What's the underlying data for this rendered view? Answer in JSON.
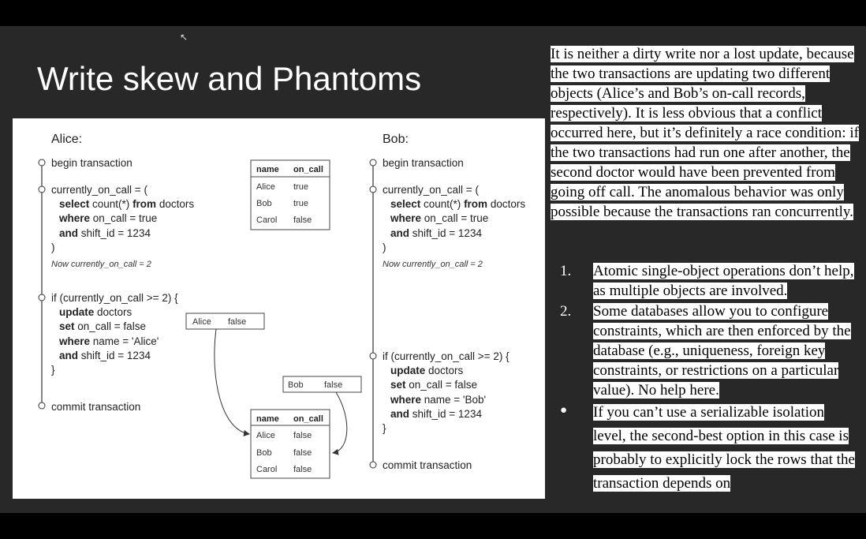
{
  "slide": {
    "title": "Write skew and Phantoms"
  },
  "diagram": {
    "alice": {
      "name": "Alice:",
      "begin": "begin transaction",
      "q_open": "currently_on_call = (",
      "q_select_kw": "select",
      "q_select_rest": " count(*) ",
      "q_from_kw": "from",
      "q_from_rest": " doctors",
      "q_where_kw": "where",
      "q_where_rest": " on_call = true",
      "q_and_kw": "and",
      "q_and_rest": " shift_id = 1234",
      "q_close": ")",
      "note": "Now currently_on_call = 2",
      "if_line": "if (currently_on_call >= 2) {",
      "u_update_kw": "update",
      "u_update_rest": " doctors",
      "u_set_kw": "set",
      "u_set_rest": " on_call = false",
      "u_where_kw": "where",
      "u_where_rest": " name = 'Alice'",
      "u_and_kw": "and",
      "u_and_rest": " shift_id = 1234",
      "if_close": "}",
      "commit": "commit transaction"
    },
    "bob": {
      "name": "Bob:",
      "begin": "begin transaction",
      "q_open": "currently_on_call = (",
      "q_select_kw": "select",
      "q_select_rest": " count(*) ",
      "q_from_kw": "from",
      "q_from_rest": " doctors",
      "q_where_kw": "where",
      "q_where_rest": " on_call = true",
      "q_and_kw": "and",
      "q_and_rest": " shift_id = 1234",
      "q_close": ")",
      "note": "Now currently_on_call = 2",
      "if_line": "if (currently_on_call >= 2) {",
      "u_update_kw": "update",
      "u_update_rest": " doctors",
      "u_set_kw": "set",
      "u_set_rest": " on_call = false",
      "u_where_kw": "where",
      "u_where_rest": " name = 'Bob'",
      "u_and_kw": "and",
      "u_and_rest": " shift_id = 1234",
      "if_close": "}",
      "commit": "commit transaction"
    },
    "table_before": {
      "headers": [
        "name",
        "on_call"
      ],
      "rows": [
        [
          "Alice",
          "true"
        ],
        [
          "Bob",
          "true"
        ],
        [
          "Carol",
          "false"
        ]
      ]
    },
    "table_after": {
      "headers": [
        "name",
        "on_call"
      ],
      "rows": [
        [
          "Alice",
          "false"
        ],
        [
          "Bob",
          "false"
        ],
        [
          "Carol",
          "false"
        ]
      ]
    },
    "alice_write": {
      "name": "Alice",
      "value": "false"
    },
    "bob_write": {
      "name": "Bob",
      "value": "false"
    }
  },
  "notes": {
    "paragraph": "It is neither a dirty write nor a lost update, because the two transactions are updating two different objects (Alice’s and Bob’s on-call records, respectively). It is less obvious that a conflict occurred here, but it’s definitely a race condition: if the two transactions had run one after another, the second doctor would have been prevented from going off call. The anomalous behavior was only possible because the transactions ran concurrently.",
    "items": [
      {
        "marker": "1.",
        "text": "Atomic single-object operations don’t help, as multiple objects are involved."
      },
      {
        "marker": "2.",
        "text": "Some databases allow you to configure constraints, which are then enforced by the database (e.g., uniqueness, foreign key constraints, or restrictions on a particular value). No help here."
      },
      {
        "marker": "●",
        "text": "If you can’t use a serializable isolation level, the second-best option in this case is probably to explicitly lock the rows that the transaction depends on"
      }
    ]
  }
}
